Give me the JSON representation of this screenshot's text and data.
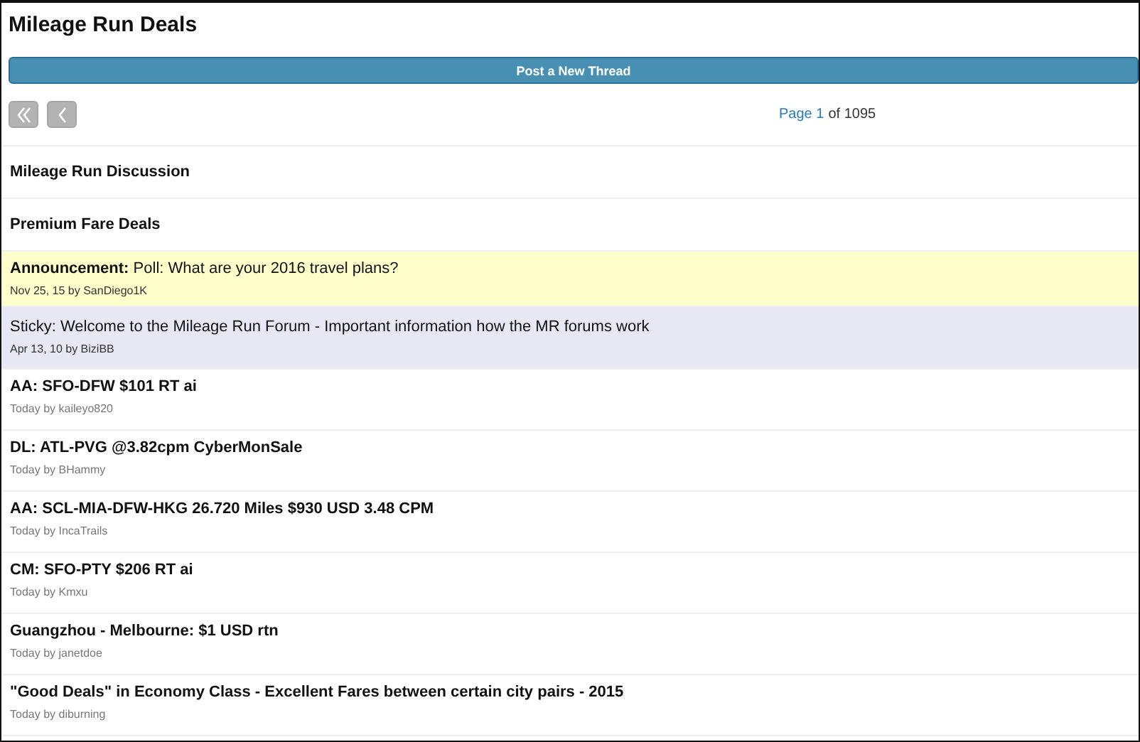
{
  "page_title": "Mileage Run Deals",
  "new_thread_button": "Post a New Thread",
  "pager": {
    "first_disabled": true,
    "prev_disabled": true,
    "page_label": "Page 1",
    "total": "of 1095"
  },
  "sections": [
    {
      "title": "Mileage Run Discussion"
    },
    {
      "title": "Premium Fare Deals"
    }
  ],
  "threads": [
    {
      "kind": "announcement",
      "title": "**Announcement:** Poll: What are your 2016 travel plans?",
      "meta": "Nov 25, 15 by SanDiego1K"
    },
    {
      "kind": "sticky",
      "title": "Sticky: Welcome to the Mileage Run Forum - Important information how the MR forums work",
      "meta": "Apr 13, 10 by BiziBB"
    },
    {
      "kind": "normal",
      "title": "AA: SFO-DFW $101 RT ai",
      "meta": "Today by kaileyo820"
    },
    {
      "kind": "normal",
      "title": "DL: ATL-PVG @3.82cpm CyberMonSale",
      "meta": "Today by BHammy"
    },
    {
      "kind": "normal",
      "title": "AA: SCL-MIA-DFW-HKG 26.720 Miles $930 USD 3.48 CPM",
      "meta": "Today by IncaTrails"
    },
    {
      "kind": "normal",
      "title": "CM: SFO-PTY $206 RT ai",
      "meta": "Today by Kmxu"
    },
    {
      "kind": "normal",
      "title": "Guangzhou - Melbourne: $1 USD rtn",
      "meta": "Today by janetdoe"
    },
    {
      "kind": "normal",
      "title": "\"Good Deals\" in Economy Class - Excellent Fares between certain city pairs - 2015",
      "meta": "Today by diburning"
    }
  ]
}
